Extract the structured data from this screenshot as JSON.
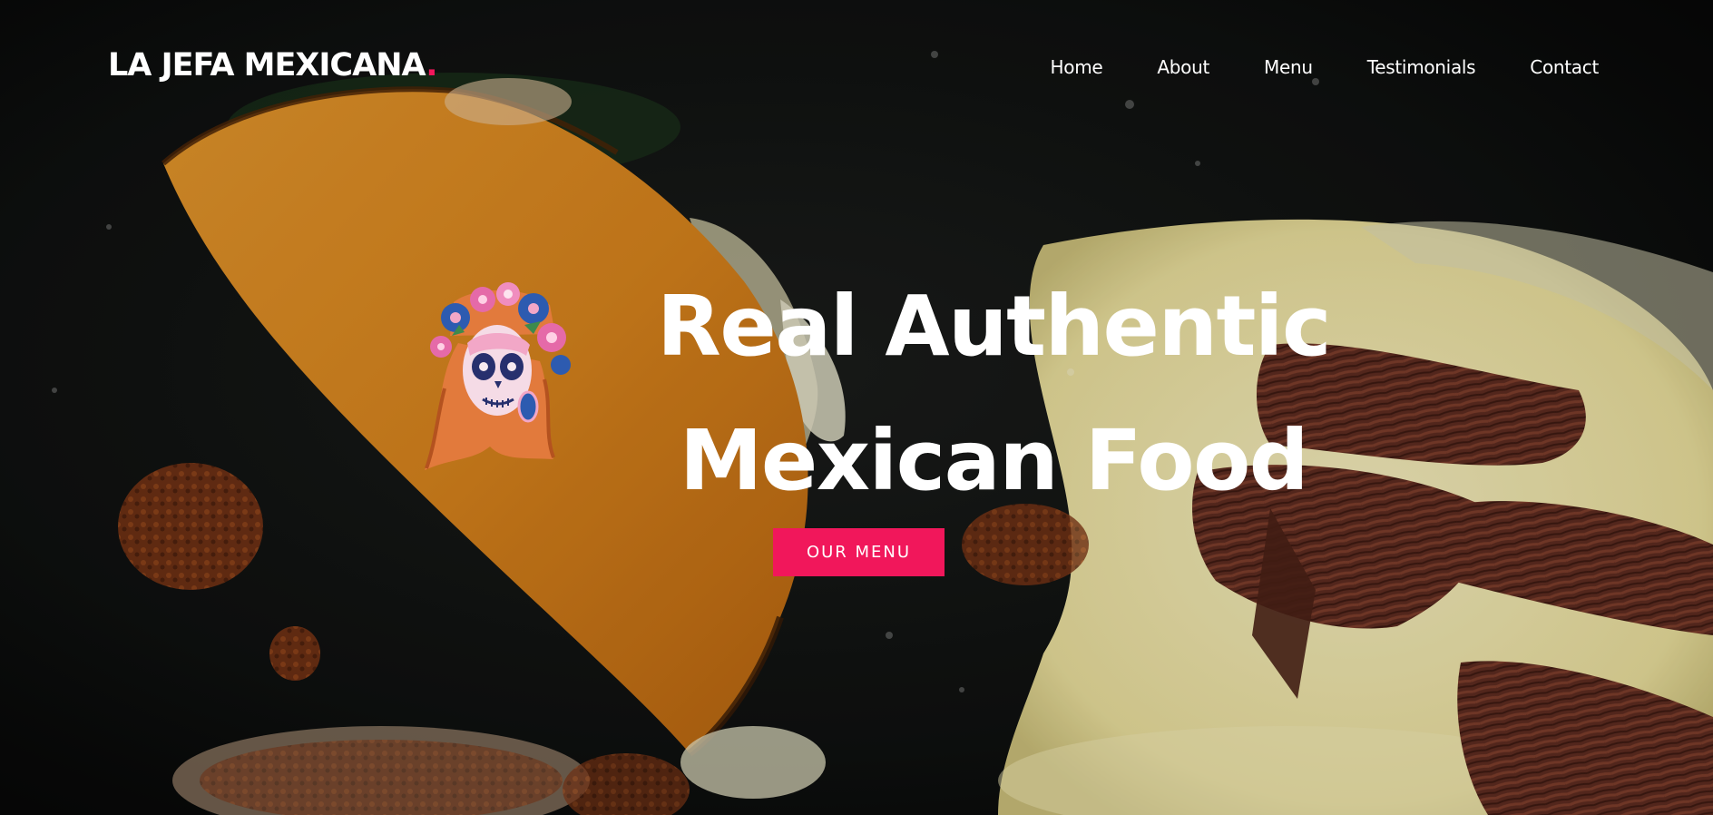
{
  "brand": {
    "name": "LA JEFA MEXICANA",
    "dot": ".",
    "dot_color": "#f1175b"
  },
  "nav": {
    "items": [
      {
        "label": "Home"
      },
      {
        "label": "About"
      },
      {
        "label": "Menu"
      },
      {
        "label": "Testimonials"
      },
      {
        "label": "Contact"
      }
    ]
  },
  "hero": {
    "title_line_1": "Real Authentic",
    "title_line_2": "Mexican Food",
    "cta_label": "OUR MENU",
    "background_image": "quesabirria taco and melted cheese with shredded beef in a dark skillet",
    "mascot_icon": "catrina-skull-icon"
  },
  "colors": {
    "accent": "#f1175b",
    "text": "#ffffff",
    "background": "#0b0c0c"
  }
}
